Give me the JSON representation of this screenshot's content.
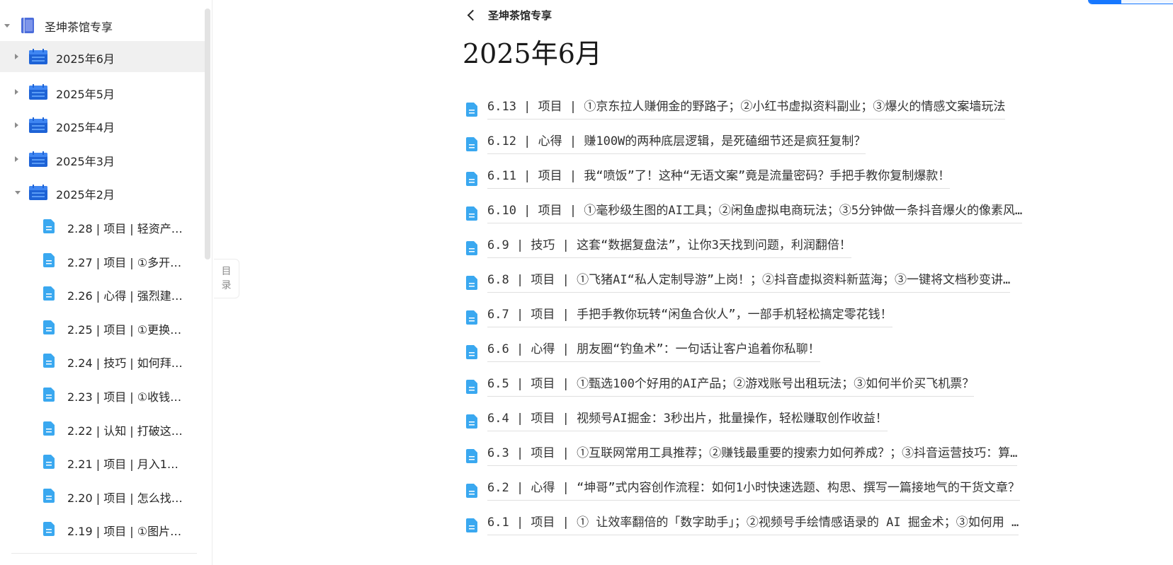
{
  "sidebar": {
    "root": {
      "label": "圣坤茶馆专享",
      "icon": "book-icon"
    },
    "months": [
      {
        "label": "2025年6月",
        "expanded": false,
        "active": true
      },
      {
        "label": "2025年5月",
        "expanded": false,
        "active": false
      },
      {
        "label": "2025年4月",
        "expanded": false,
        "active": false
      },
      {
        "label": "2025年3月",
        "expanded": false,
        "active": false
      },
      {
        "label": "2025年2月",
        "expanded": true,
        "active": false
      }
    ],
    "feb_docs": [
      "2.28 | 项目 | 轻资产…",
      "2.27 | 项目 | ①多开…",
      "2.26 | 心得 | 强烈建…",
      "2.25 | 项目 | ①更换…",
      "2.24 | 技巧 | 如何拜…",
      "2.23 | 项目 | ①收钱…",
      "2.22 | 认知 | 打破这…",
      "2.21 | 项目 | 月入1…",
      "2.20 | 项目 | 怎么找…",
      "2.19 | 项目 | ①图片…"
    ]
  },
  "toc_toggle": {
    "line1": "目",
    "line2": "录"
  },
  "header": {
    "back_label": "圣坤茶馆专享",
    "title": "2025年6月"
  },
  "documents": [
    "6.13 | 项目 | ①京东拉人赚佣金的野路子；②小红书虚拟资料副业；③爆火的情感文案墙玩法",
    "6.12 | 心得 | 赚100W的两种底层逻辑，是死磕细节还是疯狂复制？",
    "6.11 | 项目 | 我“喷饭”了！这种“无语文案”竟是流量密码？手把手教你复制爆款！",
    "6.10 | 项目 | ①毫秒级生图的AI工具；②闲鱼虚拟电商玩法；③5分钟做一条抖音爆火的像素风…",
    "6.9 | 技巧 | 这套“数据复盘法”，让你3天找到问题，利润翻倍！",
    "6.8 | 项目 | ①飞猪AI“私人定制导游”上岗！；②抖音虚拟资料新蓝海；③一键将文档秒变讲…",
    "6.7 | 项目 | 手把手教你玩转“闲鱼合伙人”，一部手机轻松搞定零花钱！",
    "6.6 | 心得 | 朋友圈“钓鱼术”：一句话让客户追着你私聊！",
    "6.5 | 项目 | ①甄选100个好用的AI产品；②游戏账号出租玩法；③如何半价买飞机票？",
    "6.4 | 项目 | 视频号AI掘金：3秒出片，批量操作，轻松赚取创作收益！",
    "6.3 | 项目 | ①互联网常用工具推荐；②赚钱最重要的搜索力如何养成？；③抖音运营技巧：算…",
    "6.2 | 心得 | “坤哥”式内容创作流程：如何1小时快速选题、构思、撰写一篇接地气的干货文章？",
    "6.1 | 项目 | ① 让效率翻倍的「数字助手」；②视频号手绘情感语录的 AI 掘金术；③如何用 …"
  ],
  "colors": {
    "accent": "#1677ff",
    "calendar_icon": "#1e63d6",
    "doc_icon": "#3aa8f0",
    "book_icon": "#4c6ddb",
    "active_row_bg": "#f0f0f0"
  }
}
